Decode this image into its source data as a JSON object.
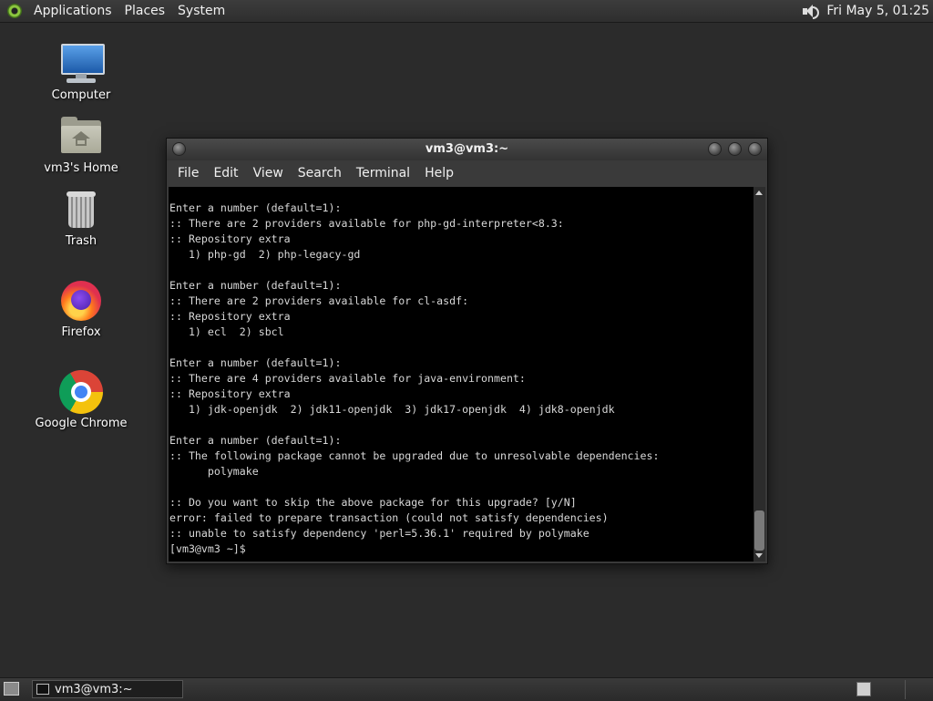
{
  "top_panel": {
    "menus": [
      "Applications",
      "Places",
      "System"
    ],
    "clock": "Fri May  5, 01:25"
  },
  "desktop": {
    "icons": [
      {
        "label": "Computer",
        "icon": "computer-icon"
      },
      {
        "label": "vm3's Home",
        "icon": "home-folder-icon"
      },
      {
        "label": "Trash",
        "icon": "trash-icon"
      },
      {
        "label": "Firefox",
        "icon": "firefox-icon"
      },
      {
        "label": "Google Chrome",
        "icon": "chrome-icon"
      }
    ]
  },
  "terminal": {
    "title": "vm3@vm3:~",
    "menu": [
      "File",
      "Edit",
      "View",
      "Search",
      "Terminal",
      "Help"
    ],
    "lines": [
      "Enter a number (default=1):",
      ":: There are 2 providers available for php-gd-interpreter<8.3:",
      ":: Repository extra",
      "   1) php-gd  2) php-legacy-gd",
      "",
      "Enter a number (default=1):",
      ":: There are 2 providers available for cl-asdf:",
      ":: Repository extra",
      "   1) ecl  2) sbcl",
      "",
      "Enter a number (default=1):",
      ":: There are 4 providers available for java-environment:",
      ":: Repository extra",
      "   1) jdk-openjdk  2) jdk11-openjdk  3) jdk17-openjdk  4) jdk8-openjdk",
      "",
      "Enter a number (default=1):",
      ":: The following package cannot be upgraded due to unresolvable dependencies:",
      "      polymake",
      "",
      ":: Do you want to skip the above package for this upgrade? [y/N]",
      "error: failed to prepare transaction (could not satisfy dependencies)",
      ":: unable to satisfy dependency 'perl=5.36.1' required by polymake",
      "[vm3@vm3 ~]$ "
    ]
  },
  "bottom_panel": {
    "task_label": "vm3@vm3:~"
  }
}
